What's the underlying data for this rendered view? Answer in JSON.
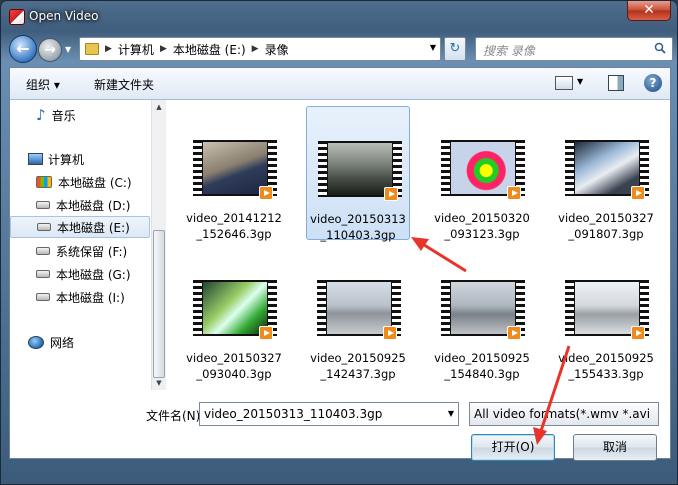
{
  "window": {
    "title": "Open Video",
    "close_glyph": "✕"
  },
  "nav": {
    "back_glyph": "←",
    "forward_glyph": "→",
    "breadcrumb": [
      "计算机",
      "本地磁盘 (E:)",
      "录像"
    ],
    "refresh_glyph": "↻",
    "search_placeholder": "搜索 录像"
  },
  "toolbar": {
    "organize_label": "组织 ▾",
    "new_folder_label": "新建文件夹",
    "help_glyph": "?"
  },
  "sidebar": {
    "music_label": "音乐",
    "computer_label": "计算机",
    "drives": [
      {
        "label": "本地磁盘 (C:)"
      },
      {
        "label": "本地磁盘 (D:)"
      },
      {
        "label": "本地磁盘 (E:)"
      },
      {
        "label": "系统保留 (F:)"
      },
      {
        "label": "本地磁盘 (G:)"
      },
      {
        "label": "本地磁盘 (I:)"
      }
    ],
    "network_label": "网络"
  },
  "files": [
    {
      "name_line1": "video_20141212",
      "name_line2": "_152646.3gp",
      "thumb": "people-indoor"
    },
    {
      "name_line1": "video_20150313",
      "name_line2": "_110403.3gp",
      "thumb": "screen-photo"
    },
    {
      "name_line1": "video_20150320",
      "name_line2": "_093123.3gp",
      "thumb": "colorful-screen"
    },
    {
      "name_line1": "video_20150327",
      "name_line2": "_091807.3gp",
      "thumb": "monitor-screen"
    },
    {
      "name_line1": "video_20150327",
      "name_line2": "_093040.3gp",
      "thumb": "green-screen"
    },
    {
      "name_line1": "video_20150925",
      "name_line2": "_142437.3gp",
      "thumb": "hall-people"
    },
    {
      "name_line1": "video_20150925",
      "name_line2": "_154840.3gp",
      "thumb": "hall-people"
    },
    {
      "name_line1": "video_20150925",
      "name_line2": "_155433.3gp",
      "thumb": "hall-bright"
    }
  ],
  "selected_file_index": 1,
  "bottom": {
    "filename_label": "文件名(N):",
    "filename_value": "video_20150313_110403.3gp",
    "filter_value": "All video formats(*.wmv *.avi",
    "open_label": "打开(O)",
    "cancel_label": "取消"
  },
  "colors": {
    "selection": "#cde0f5",
    "annotation_arrow": "#e8352b"
  }
}
